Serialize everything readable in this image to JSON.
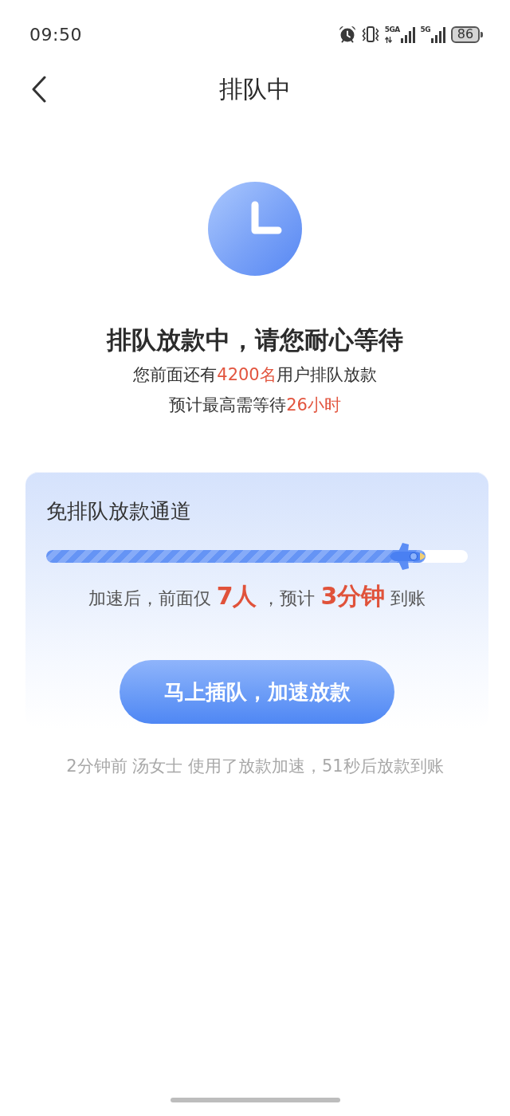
{
  "status_bar": {
    "time": "09:50",
    "signals": [
      {
        "network": "5GA",
        "data_activity": true
      },
      {
        "network": "5G",
        "data_activity": false
      }
    ],
    "battery": "86"
  },
  "nav_bar": {
    "title": "排队中"
  },
  "queue_status": {
    "headline": "排队放款中，请您耐心等待",
    "lines": [
      {
        "segments": [
          {
            "text": "您前面还有",
            "highlight": false
          },
          {
            "text": "4200名",
            "highlight": true
          },
          {
            "text": "用户排队放款",
            "highlight": false
          }
        ]
      },
      {
        "segments": [
          {
            "text": "预计最高需等待",
            "highlight": false
          },
          {
            "text": "26小时",
            "highlight": true
          }
        ]
      }
    ]
  },
  "boost_card": {
    "title": "免排队放款通道",
    "progress": {
      "level": 0.9
    },
    "summary": {
      "segments": [
        {
          "text": "加速后，前面仅 ",
          "highlight": false
        },
        {
          "text": "7人",
          "highlight": true
        },
        {
          "text": " ，预计 ",
          "highlight": false
        },
        {
          "text": "3分钟",
          "highlight": true
        },
        {
          "text": " 到账",
          "highlight": false
        }
      ]
    },
    "button": "马上插队，加速放款"
  },
  "activity_note": "2分钟前 汤女士 使用了放款加速，51秒后放款到账"
}
